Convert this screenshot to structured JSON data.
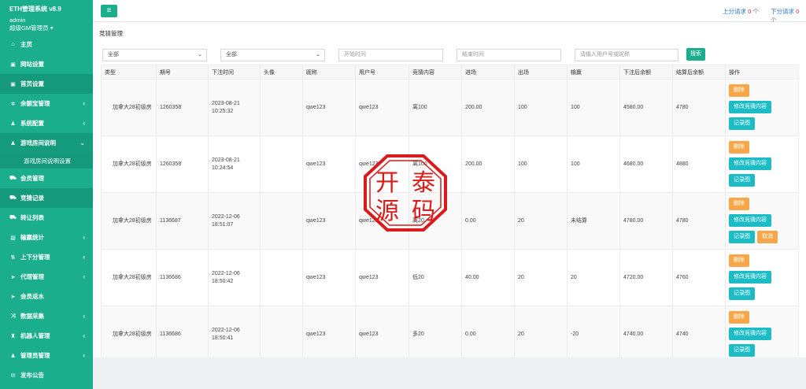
{
  "sidebar": {
    "system_title": "ETH管理系统 v8.9",
    "username": "admin",
    "role": "超级GM管理员",
    "role_caret": "▾",
    "items": [
      {
        "label": "主页",
        "icon": "home-icon",
        "glyph": "⌂",
        "has_arrow": false
      },
      {
        "label": "网站设置",
        "icon": "window-icon",
        "glyph": "▣",
        "has_arrow": false
      },
      {
        "label": "首页设置",
        "icon": "window-icon",
        "glyph": "▣",
        "has_arrow": false
      },
      {
        "label": "余额宝管理",
        "icon": "gear-icon",
        "glyph": "✲",
        "has_arrow": true
      },
      {
        "label": "系统配置",
        "icon": "user-icon",
        "glyph": "♟",
        "has_arrow": true
      },
      {
        "label": "游戏房间说明",
        "icon": "user-icon",
        "glyph": "♟",
        "has_arrow": true
      },
      {
        "label": "游戏房间说明设置",
        "icon": "",
        "glyph": "",
        "has_arrow": false
      },
      {
        "label": "会员管理",
        "icon": "car-icon",
        "glyph": "⛟",
        "has_arrow": false
      },
      {
        "label": "竞猜记录",
        "icon": "car-icon",
        "glyph": "⛟",
        "has_arrow": false
      },
      {
        "label": "转让列表",
        "icon": "car-icon",
        "glyph": "⛟",
        "has_arrow": false
      },
      {
        "label": "输赢统计",
        "icon": "chart-icon",
        "glyph": "▥",
        "has_arrow": true
      },
      {
        "label": "上下分管理",
        "icon": "arrows-icon",
        "glyph": "⇅",
        "has_arrow": true
      },
      {
        "label": "代理管理",
        "icon": "send-icon",
        "glyph": "➤",
        "has_arrow": true
      },
      {
        "label": "会员返水",
        "icon": "send-icon",
        "glyph": "➤",
        "has_arrow": false
      },
      {
        "label": "数据采集",
        "icon": "shuffle-icon",
        "glyph": "⤨",
        "has_arrow": true
      },
      {
        "label": "机器人管理",
        "icon": "robot-icon",
        "glyph": "♜",
        "has_arrow": true
      },
      {
        "label": "管理员管理",
        "icon": "user-icon",
        "glyph": "♟",
        "has_arrow": true
      },
      {
        "label": "发布公告",
        "icon": "chat-icon",
        "glyph": "✉",
        "has_arrow": false
      }
    ],
    "arrow_glyph": "‹",
    "open_arrow_glyph": "⌄"
  },
  "topbar": {
    "menu_glyph": "≡",
    "up_request_label": "上分请求",
    "up_request_count": "0",
    "up_request_unit": "个",
    "down_request_label": "下分请求",
    "down_request_count": "0",
    "down_request_unit": "个"
  },
  "page": {
    "breadcrumb": "竞猜管理"
  },
  "filters": {
    "select1": "全部",
    "select2": "全部",
    "start_placeholder": "开始时间",
    "end_placeholder": "结束时间",
    "user_placeholder": "请输入用户号或昵称",
    "search_label": "搜索",
    "caret": "⌄"
  },
  "table": {
    "columns": [
      "类型",
      "期号",
      "下注时间",
      "头像",
      "昵称",
      "用户号",
      "竞猜内容",
      "进场",
      "出场",
      "输赢",
      "下注后余额",
      "结算后余额",
      "操作"
    ],
    "rows": [
      {
        "type": "加拿大28初级房",
        "period": "1260358",
        "time1": "2023-08-21",
        "time2": "10:25:32",
        "avatar": "",
        "nickname": "qwe123",
        "userid": "qwe123",
        "content": "离100",
        "entry": "200.00",
        "exit": "100",
        "winloss": "100",
        "bal_after_bet": "4580.00",
        "bal_after_settle": "4780",
        "winloss_class": "",
        "cancel": false
      },
      {
        "type": "加拿大28初级房",
        "period": "1260358",
        "time1": "2023-08-21",
        "time2": "10:24:54",
        "avatar": "",
        "nickname": "qwe123",
        "userid": "qwe123",
        "content": "离100",
        "entry": "200.00",
        "exit": "100",
        "winloss": "100",
        "bal_after_bet": "4680.00",
        "bal_after_settle": "4880",
        "winloss_class": "",
        "cancel": false
      },
      {
        "type": "加拿大28初级房",
        "period": "1136687",
        "time1": "2022-12-06",
        "time2": "18:51:07",
        "avatar": "",
        "nickname": "qwe123",
        "userid": "qwe123",
        "content": "离20",
        "entry": "0.00",
        "exit": "20",
        "winloss": "未结算",
        "bal_after_bet": "4780.00",
        "bal_after_settle": "4780",
        "winloss_class": "unset",
        "cancel": true
      },
      {
        "type": "加拿大28初级房",
        "period": "1136686",
        "time1": "2022-12-06",
        "time2": "18:50:42",
        "avatar": "",
        "nickname": "qwe123",
        "userid": "qwe123",
        "content": "低20",
        "entry": "40.00",
        "exit": "20",
        "winloss": "20",
        "bal_after_bet": "4720.00",
        "bal_after_settle": "4760",
        "winloss_class": "",
        "cancel": false
      },
      {
        "type": "加拿大28初级房",
        "period": "1136686",
        "time1": "2022-12-06",
        "time2": "18:50:41",
        "avatar": "",
        "nickname": "qwe123",
        "userid": "qwe123",
        "content": "多20",
        "entry": "0.00",
        "exit": "20",
        "winloss": "-20",
        "bal_after_bet": "4740.00",
        "bal_after_settle": "4740",
        "winloss_class": "neg",
        "cancel": false
      }
    ],
    "actions": {
      "delete": "删除",
      "modify": "修改竞猜内容",
      "record": "记录图",
      "cancel": "取消"
    }
  },
  "watermark": {
    "chars": [
      "开",
      "泰",
      "源",
      "码"
    ],
    "color": "#d91b1b"
  }
}
